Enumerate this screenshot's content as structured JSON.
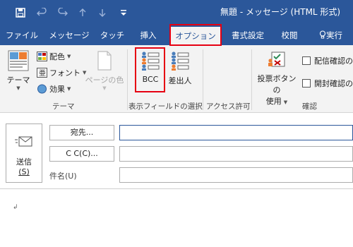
{
  "title": "無題 - メッセージ (HTML 形式)",
  "quick_access": {
    "icons": [
      "save-icon",
      "undo-icon",
      "redo-icon",
      "up-arrow-icon",
      "down-arrow-icon",
      "customize-icon"
    ]
  },
  "tabs": [
    {
      "label": "ファイル"
    },
    {
      "label": "メッセージ"
    },
    {
      "label": "タッチ"
    },
    {
      "label": "挿入"
    },
    {
      "label": "オプション",
      "active": true
    },
    {
      "label": "書式設定"
    },
    {
      "label": "校閲"
    },
    {
      "label": "実行"
    }
  ],
  "ribbon": {
    "theme_group": {
      "label": "テーマ",
      "theme_button": "テーマ",
      "colors": "配色",
      "fonts": "フォント",
      "effects": "効果",
      "page_color": "ページの色"
    },
    "show_fields_group": {
      "label": "表示フィールドの選択",
      "bcc": "BCC",
      "from": "差出人"
    },
    "permission_group": {
      "label": "アクセス許可"
    },
    "tracking_group": {
      "label": "確認",
      "voting_line1": "投票ボタンの",
      "voting_line2": "使用",
      "delivery_receipt": "配信確認の",
      "read_receipt": "開封確認の"
    }
  },
  "compose": {
    "send_label": "送信",
    "send_key": "(S)",
    "to_button": "宛先...",
    "cc_button": "C C(C)...",
    "subject_label": "件名(U)",
    "to_value": "",
    "cc_value": "",
    "subject_value": "",
    "paragraph_mark": "↲"
  },
  "colors": {
    "accent": "#2b579a",
    "highlight": "#e60012",
    "ribbon_bg": "#f3f3f3"
  }
}
